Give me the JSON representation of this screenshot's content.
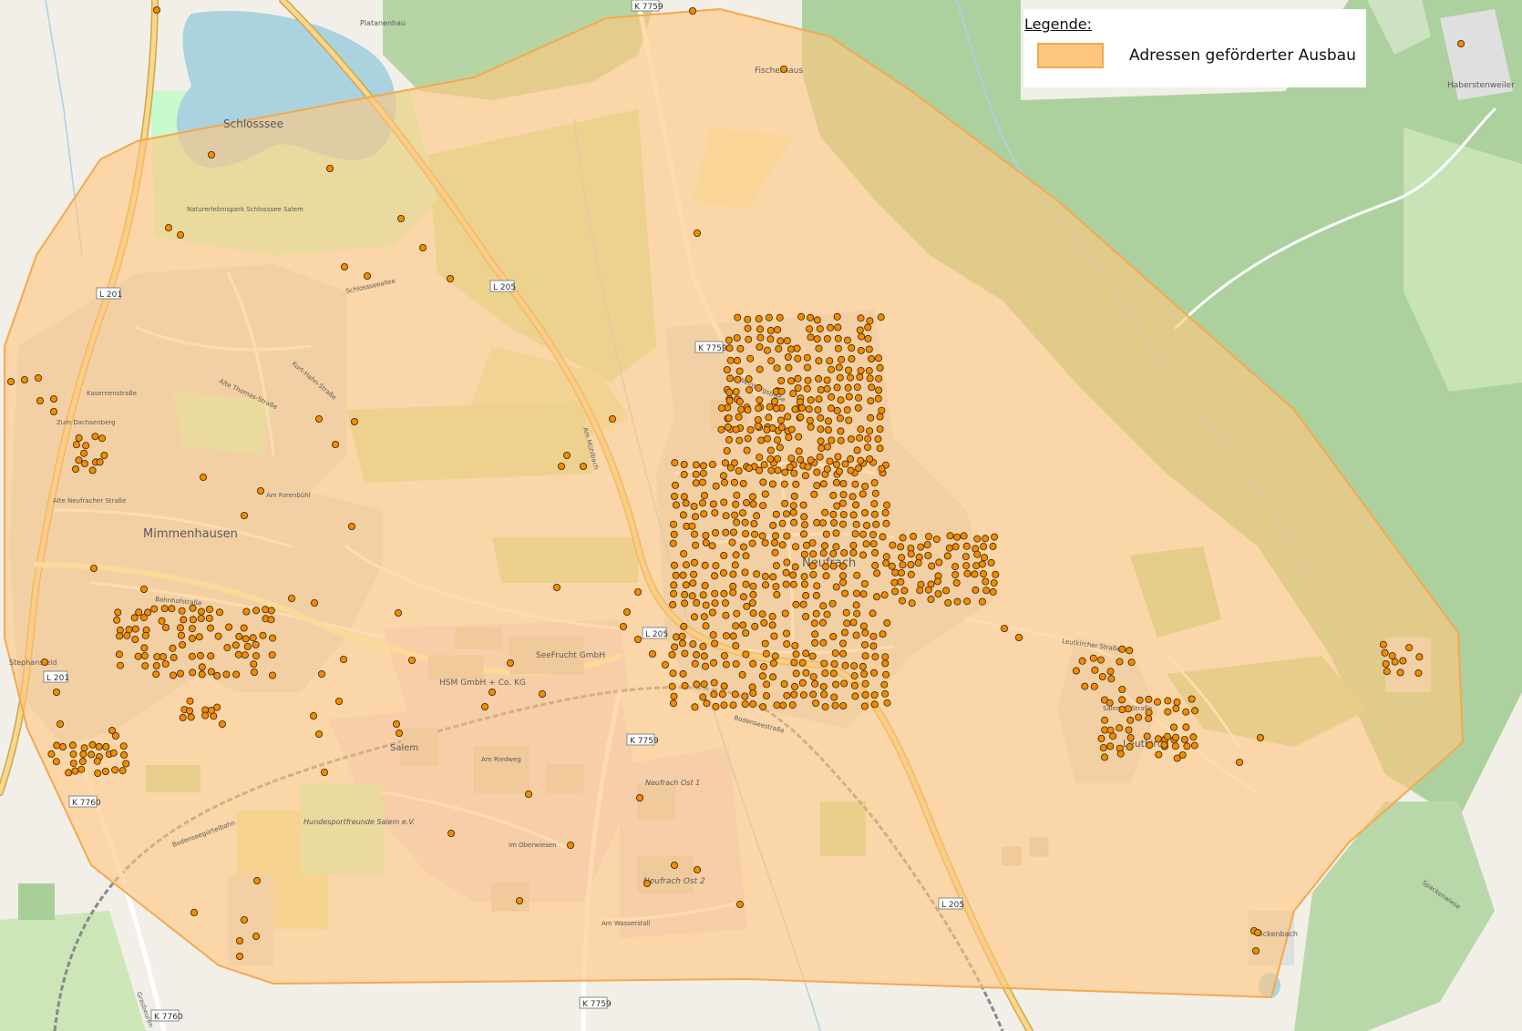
{
  "map": {
    "colors": {
      "land": "#f2efe9",
      "farmland": "#eef0d5",
      "field": "#e6e8a6",
      "forest": "#add19e",
      "water": "#aad3df",
      "residential": "#e0dfdf",
      "industrial": "#ebdbe8",
      "area_fill": "#ffc680",
      "area_stroke": "#f5a84e",
      "marker": "#f28c00"
    },
    "area_name": "Adressen geförderter Ausbau",
    "place_labels": [
      "Schlosssee",
      "Mimmenhausen",
      "Neufrach",
      "Salem",
      "Leutkirch",
      "Haberstenweiler",
      "Fischerhaus",
      "Platanenhau",
      "SeeFrucht GmbH",
      "HSM GmbH + Co. KG",
      "Hundesportfreunde Salem e.V.",
      "Neufrach Ost 1",
      "Neufrach Ost 2",
      "Stephansfeld",
      "Rickenbach",
      "Naturerlebnispark Schlosssee Salem",
      "Grasbeuren",
      "Spackenwiese",
      "Bodenseegürtelbahn"
    ],
    "street_labels": [
      "Schlossseeallee",
      "Kasernenstraße",
      "Zum Dachsenberg",
      "Alte Neufracher Straße",
      "Bahnhofstraße",
      "Bodenseestraße",
      "Am Forenbühl",
      "Weinbergstraße",
      "Leutkircher Straße",
      "Am Wasserstall",
      "Im Oberwiesen",
      "Am Riedweg",
      "Alte Thomas-Straße",
      "Kurt-Hahn-Straße",
      "Am Mühlbach",
      "Salemer Straße"
    ],
    "road_shields": [
      "K 7759",
      "L 201",
      "L 205",
      "K 7760"
    ]
  },
  "legend": {
    "title": "Legende:",
    "items": [
      {
        "label": "Adressen geförderter Ausbau",
        "fill": "#ffc680",
        "stroke": "#f5a84e"
      }
    ]
  }
}
